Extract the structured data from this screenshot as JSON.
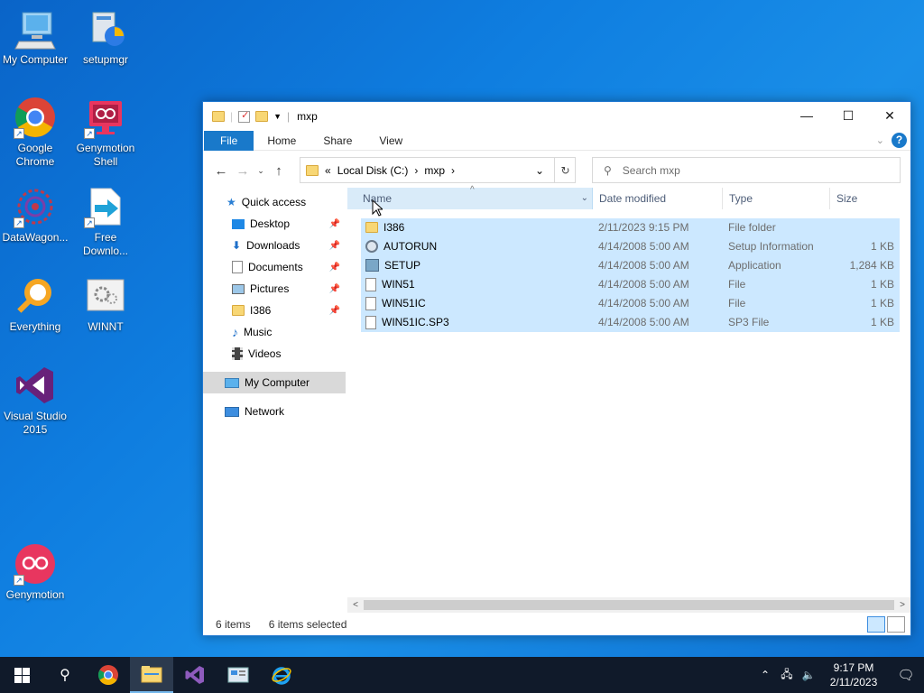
{
  "desktop": {
    "icons": [
      {
        "label": "My Computer"
      },
      {
        "label": "setupmgr"
      },
      {
        "label": "Google Chrome"
      },
      {
        "label": "Genymotion Shell"
      },
      {
        "label": "DataWagon..."
      },
      {
        "label": "Free Downlo..."
      },
      {
        "label": "Everything"
      },
      {
        "label": "WINNT"
      },
      {
        "label": "Visual Studio 2015"
      },
      {
        "label": "Genymotion"
      }
    ]
  },
  "window": {
    "title": "mxp",
    "ribbon_tabs": [
      "File",
      "Home",
      "Share",
      "View"
    ],
    "help": "?",
    "address": {
      "prefix": "«",
      "crumbs": [
        "Local Disk (C:)",
        "mxp"
      ]
    },
    "search_placeholder": "Search mxp",
    "sidebar": {
      "quick_access": "Quick access",
      "items": [
        "Desktop",
        "Downloads",
        "Documents",
        "Pictures",
        "I386",
        "Music",
        "Videos"
      ],
      "my_computer": "My Computer",
      "network": "Network"
    },
    "columns": {
      "name": "Name",
      "date": "Date modified",
      "type": "Type",
      "size": "Size"
    },
    "files": [
      {
        "name": "I386",
        "date": "2/11/2023 9:15 PM",
        "type": "File folder",
        "size": "",
        "icon": "folder-icon"
      },
      {
        "name": "AUTORUN",
        "date": "4/14/2008 5:00 AM",
        "type": "Setup Information",
        "size": "1 KB",
        "icon": "setup-info-icon"
      },
      {
        "name": "SETUP",
        "date": "4/14/2008 5:00 AM",
        "type": "Application",
        "size": "1,284 KB",
        "icon": "application-icon"
      },
      {
        "name": "WIN51",
        "date": "4/14/2008 5:00 AM",
        "type": "File",
        "size": "1 KB",
        "icon": "file-icon"
      },
      {
        "name": "WIN51IC",
        "date": "4/14/2008 5:00 AM",
        "type": "File",
        "size": "1 KB",
        "icon": "file-icon"
      },
      {
        "name": "WIN51IC.SP3",
        "date": "4/14/2008 5:00 AM",
        "type": "SP3 File",
        "size": "1 KB",
        "icon": "file-icon"
      }
    ],
    "status": {
      "count": "6 items",
      "selected": "6 items selected"
    }
  },
  "taskbar": {
    "clock_time": "9:17 PM",
    "clock_date": "2/11/2023"
  }
}
